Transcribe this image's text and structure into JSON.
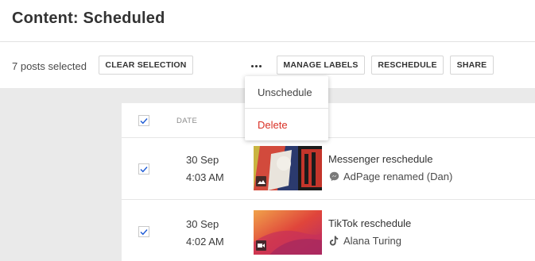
{
  "header": {
    "title": "Content:  Scheduled"
  },
  "toolbar": {
    "selected_count": "7 posts selected",
    "clear_selection": "CLEAR SELECTION",
    "more": "more-options",
    "manage_labels": "MANAGE LABELS",
    "reschedule": "RESCHEDULE",
    "share": "SHARE"
  },
  "dropdown": {
    "items": [
      "Unschedule",
      "Delete"
    ],
    "delete_color": "#d93025"
  },
  "table": {
    "columns": [
      "DATE"
    ],
    "rows": [
      {
        "date": "30 Sep",
        "time": "4:03 AM",
        "title": "Messenger reschedule",
        "account": "AdPage renamed (Dan)",
        "network_icon": "messenger-icon",
        "media_icon": "image-icon",
        "checked": true
      },
      {
        "date": "30 Sep",
        "time": "4:02 AM",
        "title": "TikTok reschedule",
        "account": "Alana Turing",
        "network_icon": "tiktok-icon",
        "media_icon": "video-icon",
        "checked": true
      }
    ]
  },
  "colors": {
    "accent": "#1565c0",
    "checkmark": "#1e5bd6",
    "content_bg": "#eaeaea"
  }
}
